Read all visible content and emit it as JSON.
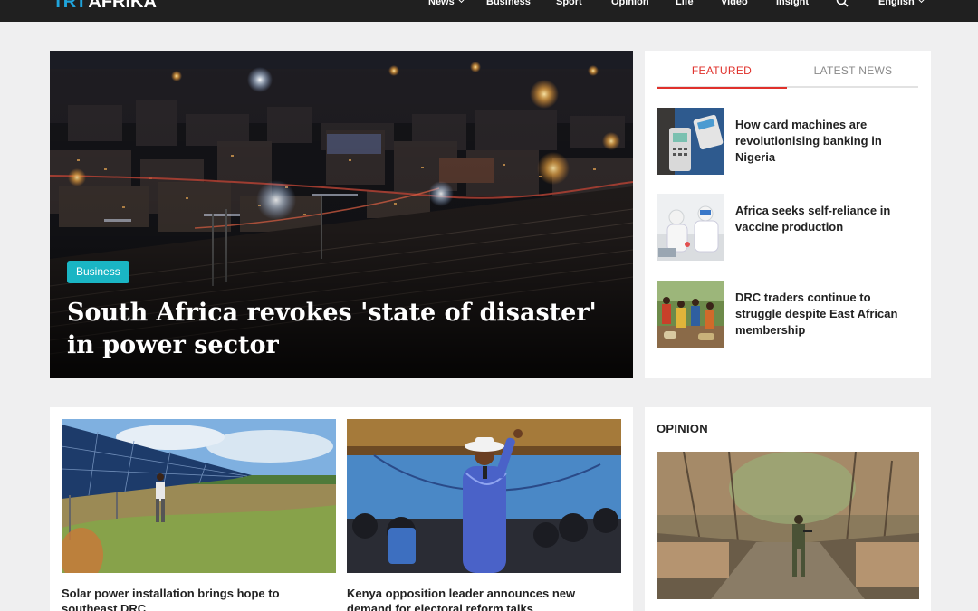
{
  "header": {
    "logo_part1": "TRT",
    "logo_part2": "AFRIKA",
    "nav": [
      {
        "label": "News",
        "dropdown": true
      },
      {
        "label": "Business",
        "dropdown": false
      },
      {
        "label": "Sport",
        "dropdown": false
      },
      {
        "label": "Opinion",
        "dropdown": false
      },
      {
        "label": "Life",
        "dropdown": false
      },
      {
        "label": "Video",
        "dropdown": false
      },
      {
        "label": "Insight",
        "dropdown": false
      }
    ],
    "language": "English"
  },
  "hero": {
    "tag": "Business",
    "headline": "South Africa revokes 'state of disaster' in power sector"
  },
  "tabs": {
    "featured": "FEATURED",
    "latest": "LATEST NEWS"
  },
  "featured": [
    {
      "title": "How card machines are revolutionising banking in Nigeria"
    },
    {
      "title": "Africa seeks self-reliance in vaccine production"
    },
    {
      "title": "DRC traders continue to struggle despite East African membership"
    }
  ],
  "cards": [
    {
      "title": "Solar power installation brings hope to southeast DRC"
    },
    {
      "title": "Kenya opposition leader announces new demand for electoral reform talks"
    }
  ],
  "opinion": {
    "header": "OPINION"
  },
  "colors": {
    "accent_red": "#e0312b",
    "tag_teal": "#1ab5c4",
    "logo_blue": "#1fa4dc",
    "topbar": "#202020"
  }
}
